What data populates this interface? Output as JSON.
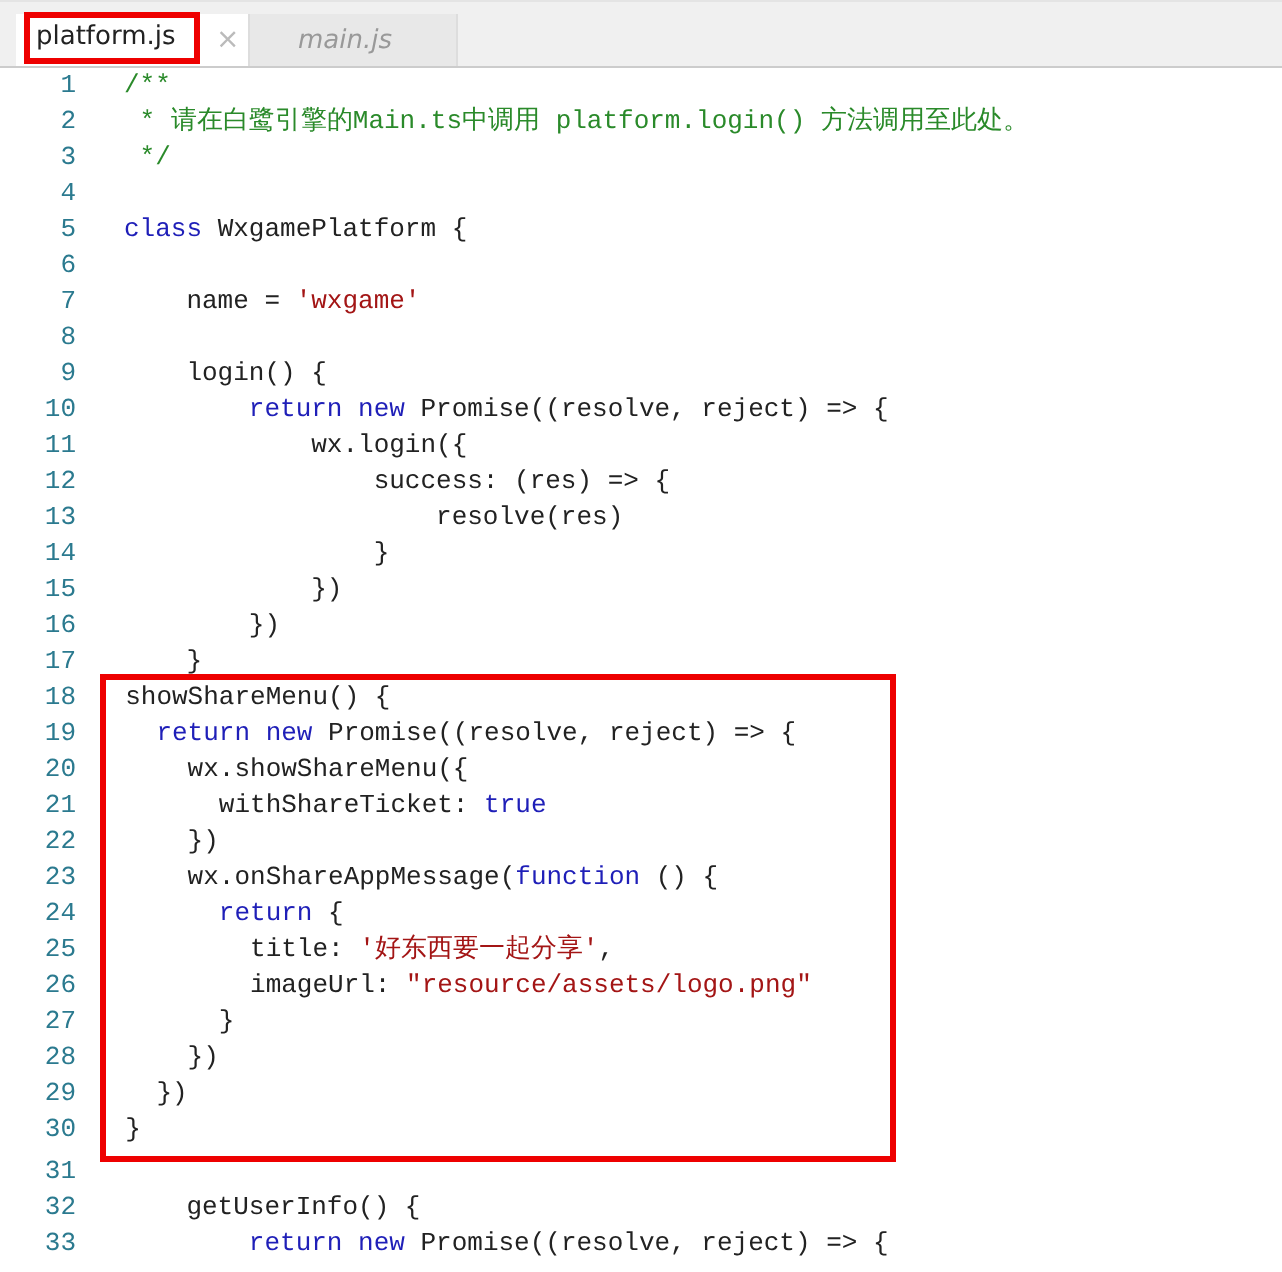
{
  "tabs": [
    {
      "label": "platform.js",
      "selected": true,
      "highlighted": true,
      "close": "×"
    },
    {
      "label": "main.js",
      "selected": false,
      "highlighted": false
    }
  ],
  "blocks": [
    {
      "boxed": false,
      "lines": [
        {
          "number": "1",
          "tokens": [
            {
              "kind": "comment",
              "text": "/**"
            }
          ]
        },
        {
          "number": "2",
          "tokens": [
            {
              "kind": "comment",
              "text": " * 请在白鹭引擎的Main.ts中调用 platform.login() 方法调用至此处。"
            }
          ]
        },
        {
          "number": "3",
          "tokens": [
            {
              "kind": "comment",
              "text": " */"
            }
          ]
        },
        {
          "number": "4"
        },
        {
          "number": "5",
          "tokens": [
            {
              "kind": "keyword",
              "text": "class"
            },
            {
              "kind": "plain",
              "text": " WxgamePlatform {"
            }
          ]
        },
        {
          "number": "6"
        },
        {
          "number": "7",
          "tokens": [
            {
              "kind": "plain",
              "text": "    name = "
            },
            {
              "kind": "string",
              "text": "'wxgame'"
            }
          ]
        },
        {
          "number": "8"
        },
        {
          "number": "9",
          "tokens": [
            {
              "kind": "plain",
              "text": "    login() {"
            }
          ]
        },
        {
          "number": "10",
          "tokens": [
            {
              "kind": "keyword",
              "text": "        return new"
            },
            {
              "kind": "plain",
              "text": " Promise((resolve, reject) => {"
            }
          ]
        },
        {
          "number": "11",
          "tokens": [
            {
              "kind": "plain",
              "text": "            wx.login({"
            }
          ]
        },
        {
          "number": "12",
          "tokens": [
            {
              "kind": "plain",
              "text": "                success: (res) => {"
            }
          ]
        },
        {
          "number": "13",
          "tokens": [
            {
              "kind": "plain",
              "text": "                    resolve(res)"
            }
          ]
        },
        {
          "number": "14",
          "tokens": [
            {
              "kind": "plain",
              "text": "                }"
            }
          ]
        },
        {
          "number": "15",
          "tokens": [
            {
              "kind": "plain",
              "text": "            })"
            }
          ]
        },
        {
          "number": "16",
          "tokens": [
            {
              "kind": "plain",
              "text": "        })"
            }
          ]
        },
        {
          "number": "17",
          "tokens": [
            {
              "kind": "plain",
              "text": "    }"
            }
          ]
        }
      ]
    },
    {
      "boxed": true,
      "lines": [
        {
          "number": "18",
          "tokens": [
            {
              "kind": "plain",
              "text": "  showShareMenu() {"
            }
          ]
        },
        {
          "number": "19",
          "tokens": [
            {
              "kind": "keyword",
              "text": "    return new"
            },
            {
              "kind": "plain",
              "text": " Promise((resolve, reject) => {"
            }
          ]
        },
        {
          "number": "20",
          "tokens": [
            {
              "kind": "plain",
              "text": "      wx.showShareMenu({"
            }
          ]
        },
        {
          "number": "21",
          "tokens": [
            {
              "kind": "plain",
              "text": "        withShareTicket: "
            },
            {
              "kind": "keyword",
              "text": "true"
            }
          ]
        },
        {
          "number": "22",
          "tokens": [
            {
              "kind": "plain",
              "text": "      })"
            }
          ]
        },
        {
          "number": "23",
          "tokens": [
            {
              "kind": "plain",
              "text": "      wx.onShareAppMessage("
            },
            {
              "kind": "keyword",
              "text": "function"
            },
            {
              "kind": "plain",
              "text": " () {"
            }
          ]
        },
        {
          "number": "24",
          "tokens": [
            {
              "kind": "keyword",
              "text": "        return"
            },
            {
              "kind": "plain",
              "text": " {"
            }
          ]
        },
        {
          "number": "25",
          "tokens": [
            {
              "kind": "plain",
              "text": "          title: "
            },
            {
              "kind": "string",
              "text": "'好东西要一起分享'"
            },
            {
              "kind": "plain",
              "text": ","
            }
          ]
        },
        {
          "number": "26",
          "tokens": [
            {
              "kind": "plain",
              "text": "          imageUrl: "
            },
            {
              "kind": "string",
              "text": "\"resource/assets/logo.png\""
            }
          ]
        },
        {
          "number": "27",
          "tokens": [
            {
              "kind": "plain",
              "text": "        }"
            }
          ]
        },
        {
          "number": "28",
          "tokens": [
            {
              "kind": "plain",
              "text": "      })"
            }
          ]
        },
        {
          "number": "29",
          "tokens": [
            {
              "kind": "plain",
              "text": "    })"
            }
          ]
        },
        {
          "number": "30",
          "tokens": [
            {
              "kind": "plain",
              "text": "  }"
            }
          ]
        }
      ]
    },
    {
      "boxed": false,
      "lines": [
        {
          "number": "31"
        },
        {
          "number": "32",
          "tokens": [
            {
              "kind": "plain",
              "text": "    getUserInfo() {"
            }
          ]
        },
        {
          "number": "33",
          "tokens": [
            {
              "kind": "keyword",
              "text": "        return new"
            },
            {
              "kind": "plain",
              "text": " Promise((resolve, reject) => {"
            }
          ]
        }
      ]
    }
  ]
}
